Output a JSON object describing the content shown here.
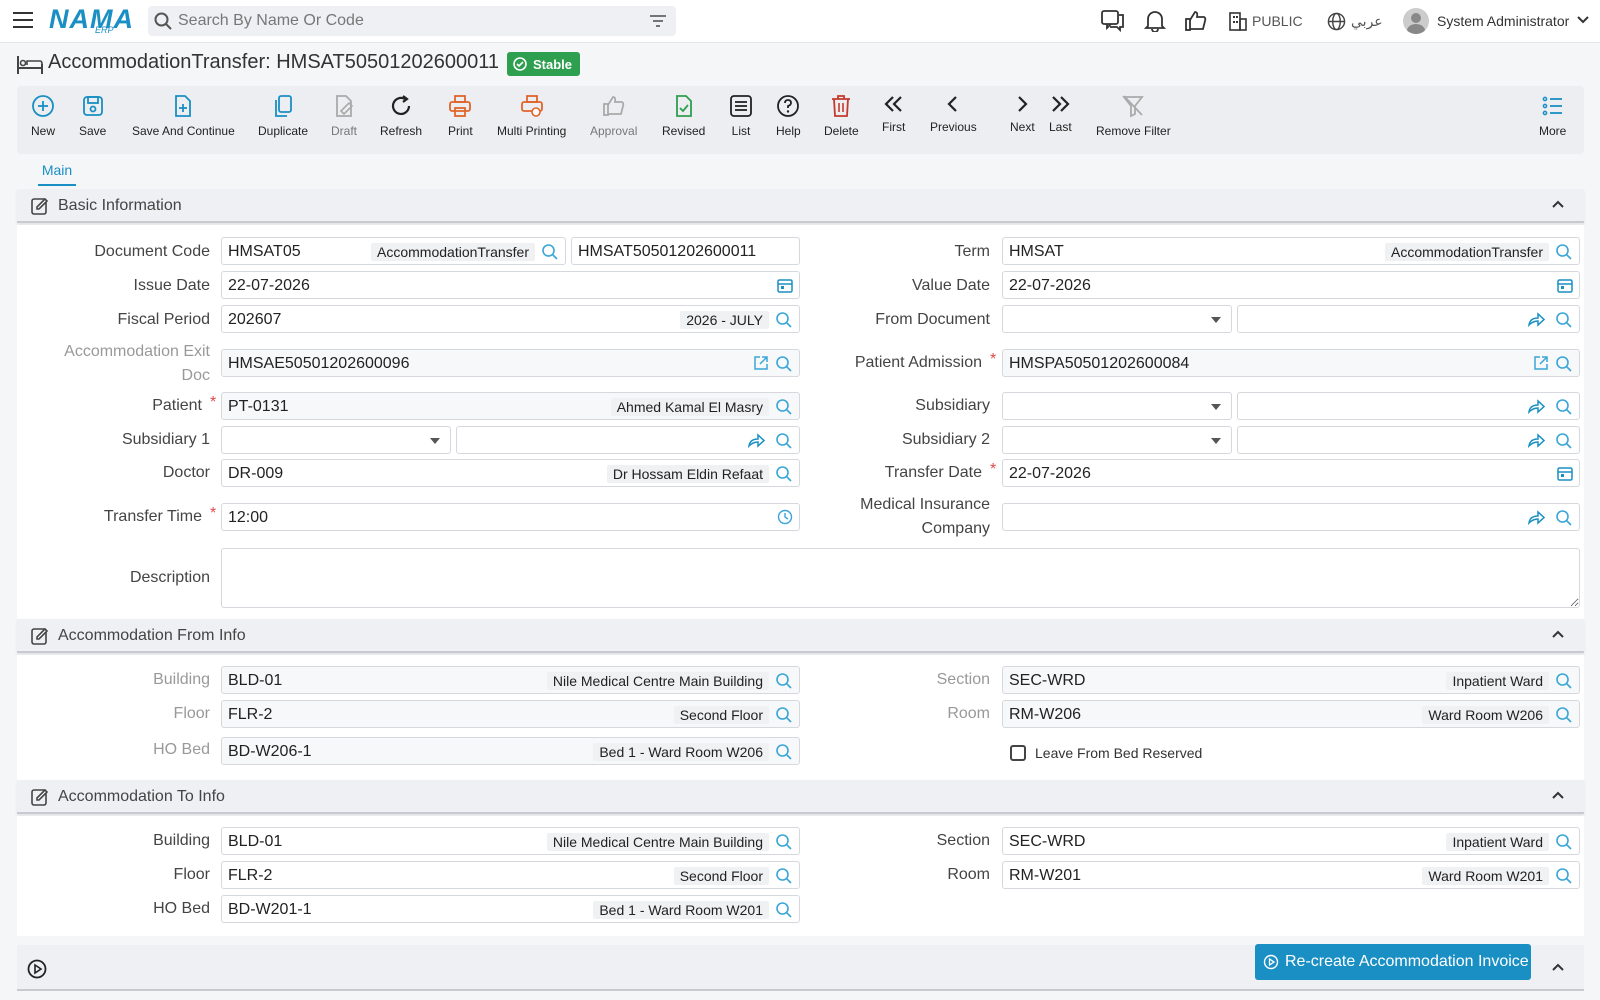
{
  "header": {
    "logo": "NAMA",
    "logo_sub": "ERP",
    "search_placeholder": "Search By Name Or Code",
    "branch": "PUBLIC",
    "language": "عربي",
    "user": "System Administrator"
  },
  "page": {
    "title": "AccommodationTransfer: HMSAT50501202600011",
    "status": "Stable"
  },
  "toolbar": {
    "new": "New",
    "save": "Save",
    "save_continue": "Save And Continue",
    "duplicate": "Duplicate",
    "draft": "Draft",
    "refresh": "Refresh",
    "print": "Print",
    "multi_printing": "Multi Printing",
    "approval": "Approval",
    "revised": "Revised",
    "list": "List",
    "help": "Help",
    "delete": "Delete",
    "first": "First",
    "previous": "Previous",
    "next": "Next",
    "last": "Last",
    "remove_filter": "Remove Filter",
    "more": "More"
  },
  "tabs": {
    "main": "Main"
  },
  "basic": {
    "title": "Basic Information",
    "document_code": {
      "label": "Document Code",
      "code": "HMSAT05",
      "desc": "AccommodationTransfer",
      "number": "HMSAT50501202600011"
    },
    "term": {
      "label": "Term",
      "code": "HMSAT",
      "desc": "AccommodationTransfer"
    },
    "issue_date": {
      "label": "Issue Date",
      "value": "22-07-2026"
    },
    "value_date": {
      "label": "Value Date",
      "value": "22-07-2026"
    },
    "fiscal_period": {
      "label": "Fiscal Period",
      "code": "202607",
      "desc": "2026 - JULY"
    },
    "from_document": {
      "label": "From Document"
    },
    "exit_doc": {
      "label1": "Accommodation Exit",
      "label2": "Doc",
      "value": "HMSAE50501202600096"
    },
    "patient_admission": {
      "label": "Patient Admission",
      "value": "HMSPA50501202600084"
    },
    "patient": {
      "label": "Patient",
      "code": "PT-0131",
      "desc": "Ahmed Kamal El Masry"
    },
    "subsidiary": {
      "label": "Subsidiary"
    },
    "subsidiary1": {
      "label": "Subsidiary 1"
    },
    "subsidiary2": {
      "label": "Subsidiary 2"
    },
    "doctor": {
      "label": "Doctor",
      "code": "DR-009",
      "desc": "Dr Hossam Eldin Refaat"
    },
    "transfer_date": {
      "label": "Transfer Date",
      "value": "22-07-2026"
    },
    "transfer_time": {
      "label": "Transfer Time",
      "value": "12:00"
    },
    "insurance": {
      "label1": "Medical Insurance",
      "label2": "Company"
    },
    "description": {
      "label": "Description"
    }
  },
  "from_info": {
    "title": "Accommodation From Info",
    "building": {
      "label": "Building",
      "code": "BLD-01",
      "desc": "Nile Medical Centre Main Building"
    },
    "section": {
      "label": "Section",
      "code": "SEC-WRD",
      "desc": "Inpatient Ward"
    },
    "floor": {
      "label": "Floor",
      "code": "FLR-2",
      "desc": "Second Floor"
    },
    "room": {
      "label": "Room",
      "code": "RM-W206",
      "desc": "Ward Room W206"
    },
    "bed": {
      "label": "HO Bed",
      "code": "BD-W206-1",
      "desc": "Bed 1 - Ward Room W206"
    },
    "leave_reserved": "Leave From Bed Reserved"
  },
  "to_info": {
    "title": "Accommodation To Info",
    "building": {
      "label": "Building",
      "code": "BLD-01",
      "desc": "Nile Medical Centre Main Building"
    },
    "section": {
      "label": "Section",
      "code": "SEC-WRD",
      "desc": "Inpatient Ward"
    },
    "floor": {
      "label": "Floor",
      "code": "FLR-2",
      "desc": "Second Floor"
    },
    "room": {
      "label": "Room",
      "code": "RM-W201",
      "desc": "Ward Room W201"
    },
    "bed": {
      "label": "HO Bed",
      "code": "BD-W201-1",
      "desc": "Bed 1 - Ward Room W201"
    }
  },
  "actions": {
    "recreate_invoice": "Re-create Accommodation Invoice"
  }
}
